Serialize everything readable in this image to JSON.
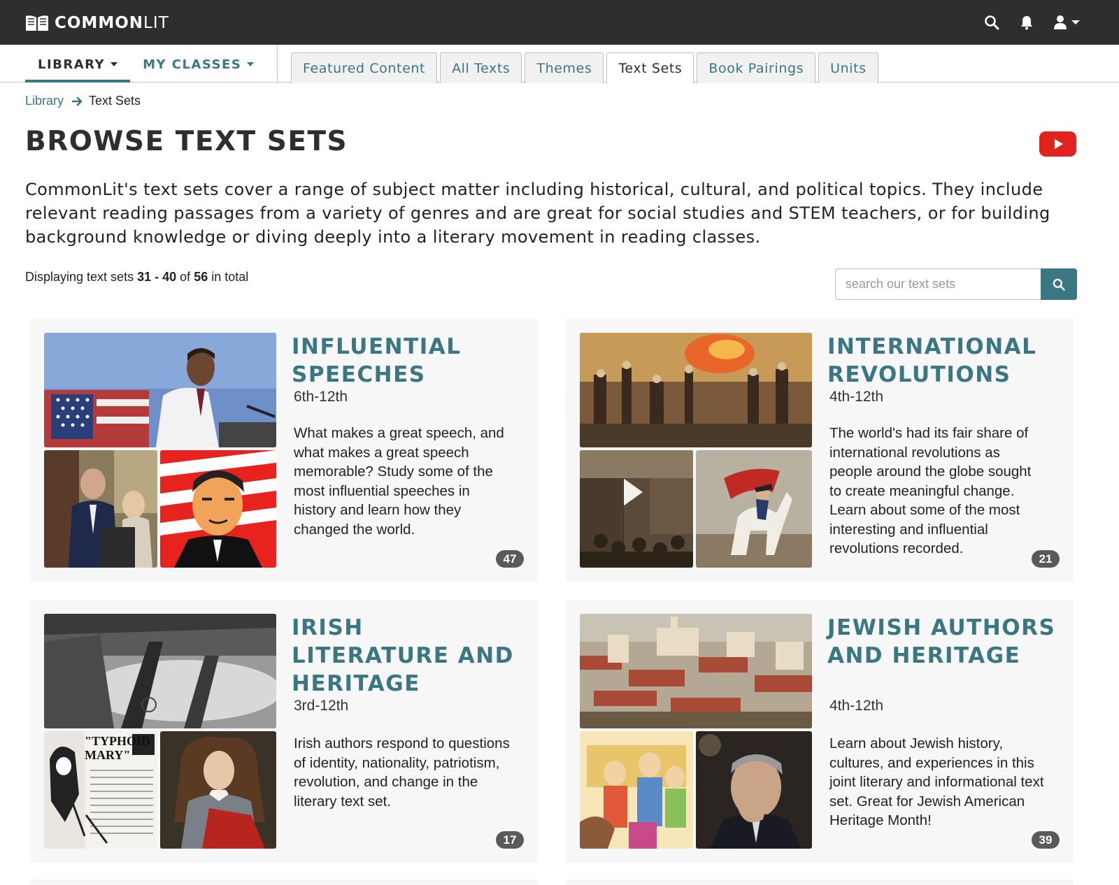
{
  "brand": {
    "name_bold": "COMMON",
    "name_light": "LIT"
  },
  "header_icons": [
    "search-icon",
    "bell-icon",
    "user-icon"
  ],
  "nav": {
    "library": "LIBRARY",
    "my_classes": "MY CLASSES",
    "tabs": [
      {
        "label": "Featured Content",
        "active": false
      },
      {
        "label": "All Texts",
        "active": false
      },
      {
        "label": "Themes",
        "active": false
      },
      {
        "label": "Text Sets",
        "active": true
      },
      {
        "label": "Book Pairings",
        "active": false
      },
      {
        "label": "Units",
        "active": false
      }
    ]
  },
  "breadcrumb": {
    "parent": "Library",
    "current": "Text Sets"
  },
  "page": {
    "title": "BROWSE TEXT SETS",
    "intro": "CommonLit's text sets cover a range of subject matter including historical, cultural, and political topics. They include relevant reading passages from a variety of genres and are great for social studies and STEM teachers, or for building background knowledge or diving deeply into a literary movement in reading classes.",
    "count": {
      "prefix": "Displaying text sets",
      "range": "31 - 40",
      "of": "of",
      "total": "56",
      "suffix": "in total"
    }
  },
  "search": {
    "placeholder": "search our text sets"
  },
  "colors": {
    "accent": "#3b7683",
    "topbar": "#2e2e2e",
    "badge": "#5a5a5a",
    "youtube": "#e0231e"
  },
  "cards": [
    {
      "title": "INFLUENTIAL SPEECHES",
      "grade": "6th-12th",
      "description": "What makes a great speech, and what makes a great speech memorable? Study some of the most influential speeches in history and learn how they changed the world.",
      "count": "47"
    },
    {
      "title": "INTERNATIONAL REVOLUTIONS",
      "grade": "4th-12th",
      "description": "The world's had its fair share of international revolutions as people around the globe sought to create meaningful change. Learn about some of the most interesting and influential revolutions recorded.",
      "count": "21"
    },
    {
      "title": "IRISH LITERATURE AND HERITAGE",
      "grade": "3rd-12th",
      "description": "Irish authors respond to questions of identity, nationality, patriotism, revolution, and change in the literary text set.",
      "count": "17",
      "image_text": "\"TYPHOID MARY\""
    },
    {
      "title": "JEWISH AUTHORS AND HERITAGE",
      "grade": "4th-12th",
      "description": "Learn about Jewish history, cultures, and experiences in this joint literary and informational text set. Great for Jewish American Heritage Month!",
      "count": "39"
    }
  ]
}
